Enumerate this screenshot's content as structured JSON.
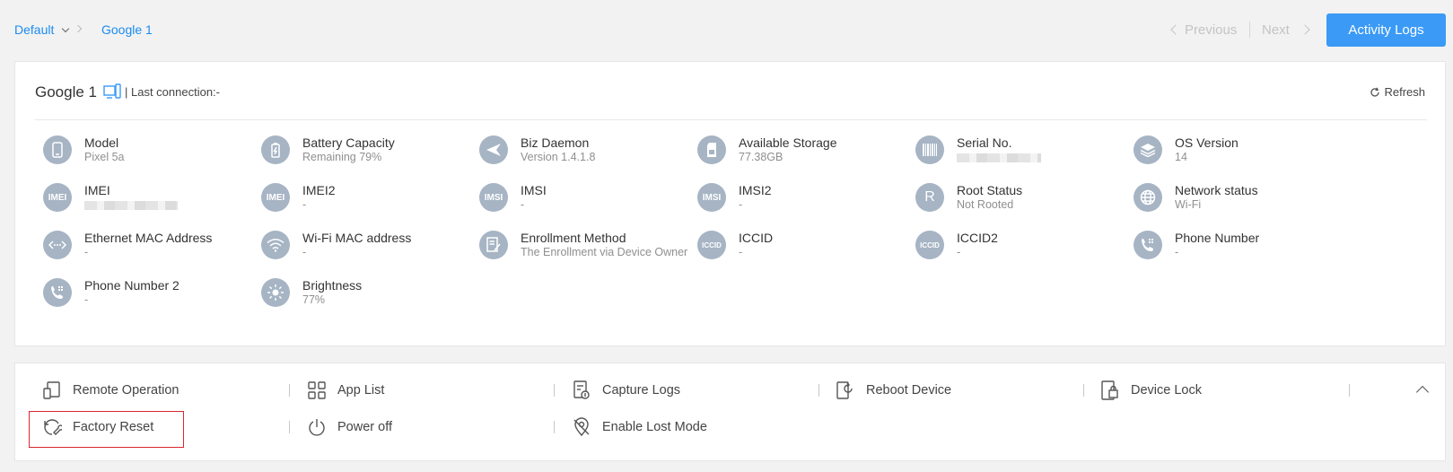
{
  "breadcrumb": {
    "group": "Default",
    "device": "Google 1"
  },
  "pager": {
    "previous": "Previous",
    "next": "Next"
  },
  "activity_button": "Activity Logs",
  "device": {
    "name": "Google 1",
    "last_connection": "| Last connection:-",
    "refresh": "Refresh"
  },
  "info": [
    {
      "icon": "phone-icon",
      "label": "Model",
      "value": "Pixel 5a"
    },
    {
      "icon": "battery-icon",
      "label": "Battery Capacity",
      "value": "Remaining 79%"
    },
    {
      "icon": "send-icon",
      "label": "Biz Daemon",
      "value": "Version 1.4.1.8"
    },
    {
      "icon": "sd-card-icon",
      "label": "Available Storage",
      "value": "77.38GB"
    },
    {
      "icon": "barcode-icon",
      "label": "Serial No.",
      "value": ""
    },
    {
      "icon": "layers-icon",
      "label": "OS Version",
      "value": "14"
    },
    {
      "icon": "imei-icon",
      "label": "IMEI",
      "value": "",
      "icon_text": "IMEI"
    },
    {
      "icon": "imei2-icon",
      "label": "IMEI2",
      "value": "-",
      "icon_text": "IMEI"
    },
    {
      "icon": "imsi-icon",
      "label": "IMSI",
      "value": "-",
      "icon_text": "IMSI"
    },
    {
      "icon": "imsi2-icon",
      "label": "IMSI2",
      "value": "-",
      "icon_text": "IMSI"
    },
    {
      "icon": "root-icon",
      "label": "Root Status",
      "value": "Not Rooted",
      "icon_text": "R"
    },
    {
      "icon": "globe-icon",
      "label": "Network status",
      "value": "Wi-Fi"
    },
    {
      "icon": "ethernet-icon",
      "label": "Ethernet MAC Address",
      "value": "-"
    },
    {
      "icon": "wifi-icon",
      "label": "Wi-Fi MAC address",
      "value": "-"
    },
    {
      "icon": "form-icon",
      "label": "Enrollment Method",
      "value": "The Enrollment via Device Owner"
    },
    {
      "icon": "iccid-icon",
      "label": "ICCID",
      "value": "-",
      "icon_text": "ICCID"
    },
    {
      "icon": "iccid2-icon",
      "label": "ICCID2",
      "value": "-",
      "icon_text": "ICCID"
    },
    {
      "icon": "phone-number-icon",
      "label": "Phone Number",
      "value": "-"
    },
    {
      "icon": "phone-number-2-icon",
      "label": "Phone Number 2",
      "value": "-"
    },
    {
      "icon": "brightness-icon",
      "label": "Brightness",
      "value": "77%"
    }
  ],
  "actions": [
    {
      "icon": "remote-operation-icon",
      "label": "Remote Operation"
    },
    {
      "icon": "app-list-icon",
      "label": "App List"
    },
    {
      "icon": "capture-logs-icon",
      "label": "Capture Logs"
    },
    {
      "icon": "reboot-icon",
      "label": "Reboot Device"
    },
    {
      "icon": "device-lock-icon",
      "label": "Device Lock"
    },
    {
      "icon": "factory-reset-icon",
      "label": "Factory Reset"
    },
    {
      "icon": "power-icon",
      "label": "Power off"
    },
    {
      "icon": "lost-mode-icon",
      "label": "Enable Lost Mode"
    }
  ],
  "colors": {
    "accent": "#3b9af6",
    "link": "#1a8cf0",
    "icon_bg": "#a6b4c4",
    "highlight": "#d9272e"
  }
}
